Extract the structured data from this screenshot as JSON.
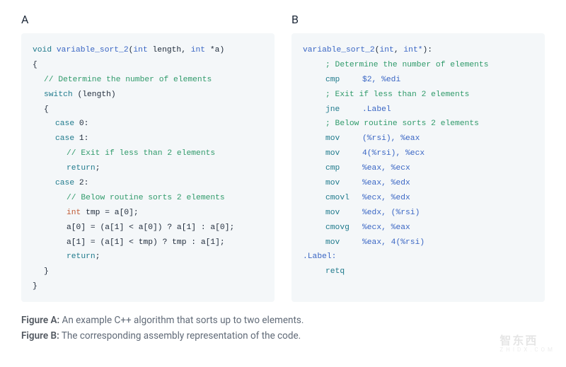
{
  "labels": {
    "A": "A",
    "B": "B"
  },
  "code_a": {
    "sig_void": "void",
    "sig_fn": "variable_sort_2",
    "sig_open": "(",
    "sig_t1": "int",
    "sig_t1_name": " length, ",
    "sig_t2": "int",
    "sig_t2_ptr": " *a",
    "sig_close": ")",
    "brace_open": "{",
    "c1": "// Determine the number of elements",
    "kw_switch": "switch",
    "switch_expr": " (length)",
    "brace2_open": "{",
    "kw_case0": "case",
    "case0_v": " 0:",
    "kw_case1": "case",
    "case1_v": " 1:",
    "c2": "// Exit if less than 2 elements",
    "kw_return1": "return",
    "ret1_semi": ";",
    "kw_case2": "case",
    "case2_v": " 2:",
    "c3": "// Below routine sorts 2 elements",
    "tmp_type": "int",
    "tmp_rest": " tmp = a[0];",
    "stmt1": "a[0] = (a[1] < a[0]) ? a[1] : a[0];",
    "stmt2": "a[1] = (a[1] < tmp) ? tmp : a[1];",
    "kw_return2": "return",
    "ret2_semi": ";",
    "brace2_close": "}",
    "brace_close": "}"
  },
  "code_b": {
    "fn": "variable_sort_2",
    "sig_open": "(",
    "t1": "int",
    "comma": ", ",
    "t2": "int*",
    "sig_close": "):",
    "c1": "; Determine the number of elements",
    "op_cmp1": "cmp",
    "arg_cmp1": "$2, %edi",
    "c2": "; Exit if less than 2 elements",
    "op_jne": "jne",
    "arg_jne": ".Label",
    "c3": "; Below routine sorts 2 elements",
    "op_mov1": "mov",
    "arg_mov1": "(%rsi), %eax",
    "op_mov2": "mov",
    "arg_mov2": "4(%rsi), %ecx",
    "op_cmp2": "cmp",
    "arg_cmp2": "%eax, %ecx",
    "op_mov3": "mov",
    "arg_mov3": "%eax, %edx",
    "op_cmovl": "cmovl",
    "arg_cmovl": "%ecx, %edx",
    "op_mov4": "mov",
    "arg_mov4": "%edx, (%rsi)",
    "op_cmovg": "cmovg",
    "arg_cmovg": "%ecx, %eax",
    "op_mov5": "mov",
    "arg_mov5": "%eax, 4(%rsi)",
    "label": ".Label:",
    "op_retq": "retq"
  },
  "captions": {
    "a_bold": "Figure A:",
    "a_text": " An example C++ algorithm that sorts up to two elements.",
    "b_bold": "Figure B:",
    "b_text": " The corresponding assembly representation of the code."
  },
  "watermark": {
    "main": "智东西",
    "sub": "Z H I D X . C O M"
  }
}
